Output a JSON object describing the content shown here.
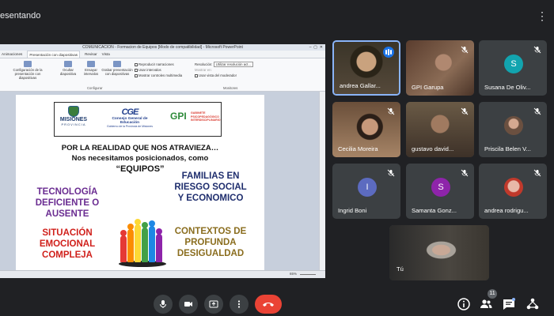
{
  "top_bar": {
    "presenting_label": "esentando",
    "more_icon": "more-vert-icon"
  },
  "shared_screen": {
    "window_title": "COMUNICACION - Formacion de Equipos [Modo de compatibilidad] - Microsoft PowerPoint",
    "ribbon_tabs": [
      "Animaciones",
      "Presentación con diapositivas",
      "Revisar",
      "Vista"
    ],
    "ribbon": {
      "config_label": "Configuración de la presentación con diapositivas",
      "hide_label": "Ocultar diapositiva",
      "rehearse_label": "Ensayar intervalos",
      "record_label": "Grabar presentación con diapositivas",
      "checks": [
        "Reproducir narraciones",
        "Usar intervalos",
        "Mostrar controles multimedia"
      ],
      "resolution_label": "Resolución:",
      "resolution_value": "Utilizar resolución act...",
      "show_on_label": "Mostrar en:",
      "presenter_label": "Usar vista del moderador",
      "group_configure": "Configurar",
      "group_monitors": "Monitores"
    },
    "status_zoom": "65%",
    "slide": {
      "logo_misiones_title": "MISIONES",
      "logo_misiones_sub": "PROVINCIA",
      "logo_cge_mark": "CGE",
      "logo_cge_title": "Consejo General de Educación",
      "logo_cge_sub": "Gobierno de la Provincia de Misiones",
      "logo_gpi_mark": "GPI",
      "logo_gpi_text": "GABINETE PSICOPEDAGÓGICO INTERDISCIPLINARIO",
      "line1": "POR LA REALIDAD QUE NOS ATRAVIEZA…",
      "line2": "Nos necesitamos posicionados, como",
      "line3": "“EQUIPOS”",
      "left_top": "TECNOLOGÍA DEFICIENTE O AUSENTE",
      "left_bottom": "SITUACIÓN EMOCIONAL COMPLEJA",
      "right_top": "FAMILIAS EN RIESGO SOCIAL Y ECONOMICO",
      "right_bottom": "CONTEXTOS DE PROFUNDA DESIGUALDAD",
      "colors": {
        "purple": "#6a2c91",
        "red": "#d0201b",
        "navy": "#1f2e6e",
        "olive": "#8a6d1e"
      }
    }
  },
  "participants": [
    {
      "name": "andrea Gallar...",
      "type": "video",
      "speaking": true
    },
    {
      "name": "GPI Garupa",
      "type": "video",
      "muted": true
    },
    {
      "name": "Susana De Oliv...",
      "type": "avatar",
      "initial": "S",
      "color": "#12a4af",
      "muted": true
    },
    {
      "name": "Cecilia Moreira",
      "type": "video",
      "muted": true
    },
    {
      "name": "gustavo david...",
      "type": "video",
      "muted": true
    },
    {
      "name": "Priscila Belen V...",
      "type": "photo",
      "muted": true
    },
    {
      "name": "Ingrid Boni",
      "type": "avatar",
      "initial": "I",
      "color": "#5c6bc0",
      "muted": true
    },
    {
      "name": "Samanta Gonz...",
      "type": "avatar",
      "initial": "S",
      "color": "#8e24aa",
      "muted": true
    },
    {
      "name": "andrea rodrigu...",
      "type": "photo",
      "muted": true
    },
    {
      "name": "Tú",
      "type": "video",
      "self": true
    }
  ],
  "controls": {
    "mic": "mic-icon",
    "camera": "camera-icon",
    "present": "present-screen-icon",
    "more": "more-options-icon",
    "end": "end-call-icon"
  },
  "right_controls": {
    "info": "info-icon",
    "people": "people-icon",
    "people_count": "11",
    "chat": "chat-icon",
    "activities": "activities-icon"
  }
}
